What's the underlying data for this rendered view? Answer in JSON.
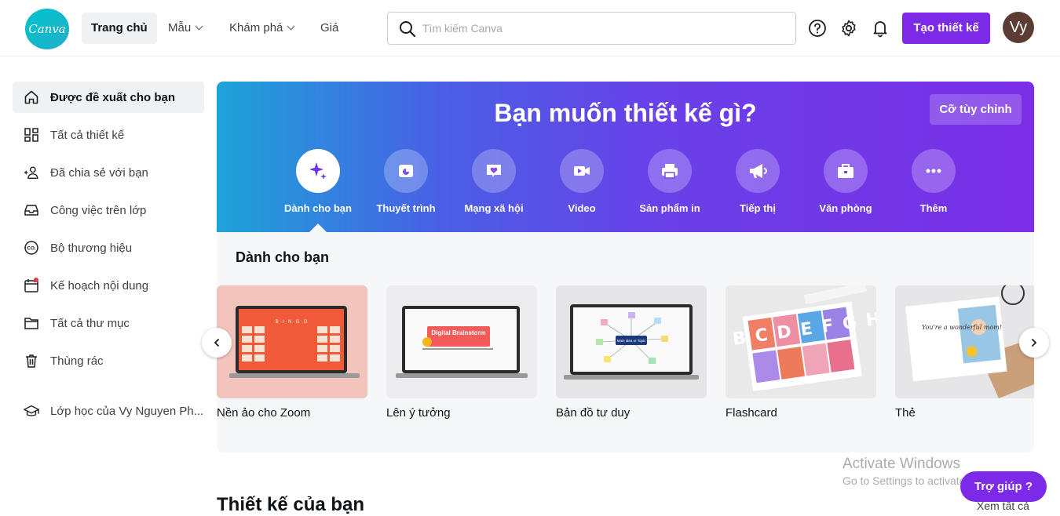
{
  "header": {
    "logo_text": "Canva",
    "nav": [
      {
        "label": "Trang chủ"
      },
      {
        "label": "Mẫu"
      },
      {
        "label": "Khám phá"
      },
      {
        "label": "Giá"
      }
    ],
    "search_placeholder": "Tìm kiếm Canva",
    "create_label": "Tạo thiết kế",
    "avatar_initials": "Vy",
    "icons": [
      "help-icon",
      "settings-icon",
      "bell-icon"
    ]
  },
  "sidebar": {
    "items": [
      {
        "label": "Được đề xuất cho bạn",
        "icon": "home-icon"
      },
      {
        "label": "Tất cả thiết kế",
        "icon": "grid-icon"
      },
      {
        "label": "Đã chia sẻ với bạn",
        "icon": "shared-users-icon"
      },
      {
        "label": "Công việc trên lớp",
        "icon": "inbox-icon"
      },
      {
        "label": "Bộ thương hiệu",
        "icon": "brand-icon"
      },
      {
        "label": "Kế hoạch nội dung",
        "icon": "calendar-icon"
      },
      {
        "label": "Tất cả thư mục",
        "icon": "folder-icon"
      },
      {
        "label": "Thùng rác",
        "icon": "trash-icon"
      },
      {
        "label": "Lớp học của Vy Nguyen Ph...",
        "icon": "graduation-cap-icon"
      }
    ]
  },
  "hero": {
    "title": "Bạn muốn thiết kế gì?",
    "custom_size_label": "Cỡ tùy chỉnh",
    "categories": [
      {
        "label": "Dành cho bạn",
        "icon": "sparkle-icon"
      },
      {
        "label": "Thuyết trình",
        "icon": "presentation-icon"
      },
      {
        "label": "Mạng xã hội",
        "icon": "heart-chat-icon"
      },
      {
        "label": "Video",
        "icon": "video-camera-icon"
      },
      {
        "label": "Sản phẩm in",
        "icon": "printer-icon"
      },
      {
        "label": "Tiếp thị",
        "icon": "megaphone-icon"
      },
      {
        "label": "Văn phòng",
        "icon": "briefcase-icon"
      },
      {
        "label": "Thêm",
        "icon": "more-icon"
      }
    ]
  },
  "for_you": {
    "title": "Dành cho bạn",
    "cards": [
      {
        "label": "Nền ảo cho Zoom",
        "thumb_text": "B · I · N · G · O"
      },
      {
        "label": "Lên ý tưởng",
        "thumb_text": "Digital Brainstorm"
      },
      {
        "label": "Bản đồ tư duy",
        "thumb_text": "Main idea or Topic"
      },
      {
        "label": "Flashcard",
        "thumb_text": "ABCDEFGH"
      },
      {
        "label": "Thẻ",
        "thumb_text": "You're a wonderful mom!"
      }
    ]
  },
  "designs": {
    "title": "Thiết kế của bạn",
    "view_all": "Xem tất cả"
  },
  "overlay": {
    "activate_title": "Activate Windows",
    "activate_sub": "Go to Settings to activate Windows.",
    "help_label": "Trợ giúp ?"
  }
}
